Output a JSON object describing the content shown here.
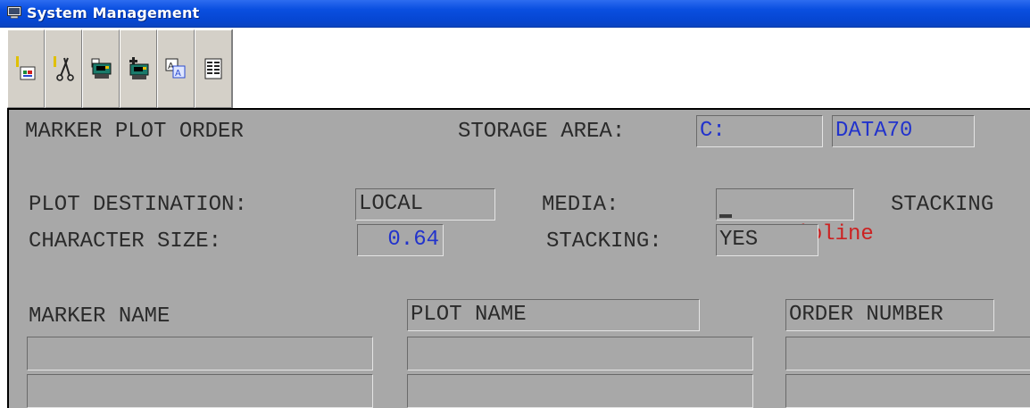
{
  "window": {
    "title": "System Management",
    "title_icon": "terminal-window-icon"
  },
  "toolbar": {
    "buttons": [
      {
        "icon": "new-form-icon"
      },
      {
        "icon": "scissors-cut-icon"
      },
      {
        "icon": "plotter-send-icon"
      },
      {
        "icon": "plotter-queue-icon"
      },
      {
        "icon": "text-font-icon"
      },
      {
        "icon": "list-columns-icon"
      }
    ]
  },
  "form": {
    "heading": "MARKER PLOT ORDER",
    "storage_area_label": "STORAGE AREA:",
    "storage_drive": "C:",
    "storage_folder": "DATA70",
    "plot_destination_label": "PLOT DESTINATION:",
    "plot_destination": "LOCAL",
    "media_label": "MEDIA:",
    "media": "ioline",
    "stacking_right_label": "STACKING",
    "character_size_label": "CHARACTER SIZE:",
    "character_size": "0.64",
    "stacking_label": "STACKING:",
    "stacking": "YES",
    "columns": {
      "marker_name": "MARKER NAME",
      "plot_name": "PLOT NAME",
      "order_number": "ORDER NUMBER"
    },
    "rows": [
      {
        "marker_name": "",
        "plot_name": "",
        "order_number": ""
      },
      {
        "marker_name": "",
        "plot_name": "",
        "order_number": ""
      }
    ]
  },
  "colors": {
    "titlebar": "#0646d2",
    "panel": "#a8a8a8",
    "value_blue": "#2233cc",
    "value_red": "#cc2222"
  }
}
